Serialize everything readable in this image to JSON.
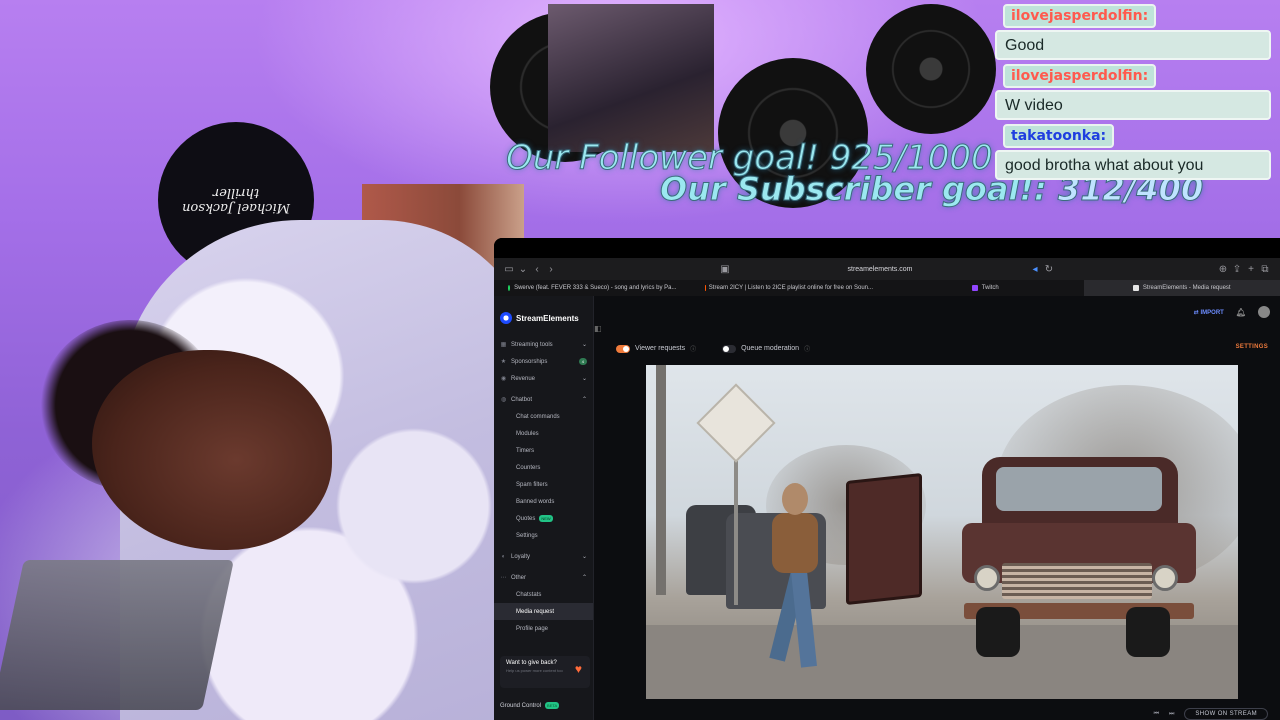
{
  "overlay": {
    "follower_goal": "Our Follower goal! 925/1000",
    "subscriber_goal_label": "Our Subscriber goal!:",
    "subscriber_goal_value": "312/400",
    "record_text": "Michael Jackson thriller"
  },
  "chat": [
    {
      "user": "ilovejasperdolfin:",
      "message": "Good",
      "user_color": "#ff5a4e"
    },
    {
      "user": "ilovejasperdolfin:",
      "message": "W video",
      "user_color": "#ff5a4e"
    },
    {
      "user": "takatoonka:",
      "message": "good brotha what about you",
      "user_color": "#1f3ee0"
    }
  ],
  "browser": {
    "url": "streamelements.com",
    "tabs": [
      {
        "label": "Swerve (feat. FEVER 333 & Sueco) - song and lyrics by Pa...",
        "color": "#1ed760"
      },
      {
        "label": "Stream 2ICY | Listen to 2ICE playlist online for free on Soun...",
        "color": "#ff5500"
      },
      {
        "label": "Twitch",
        "color": "#9146ff"
      },
      {
        "label": "StreamElements - Media request",
        "color": "#e6e6e6"
      }
    ]
  },
  "app": {
    "brand": "StreamElements",
    "import_label": "IMPORT",
    "settings_label": "SETTINGS",
    "viewer_requests_label": "Viewer requests",
    "queue_moderation_label": "Queue moderation",
    "show_on_stream_label": "SHOW ON STREAM",
    "sidebar": {
      "streaming_tools": "Streaming tools",
      "sponsorships": "Sponsorships",
      "sponsorships_count": "4",
      "revenue": "Revenue",
      "chatbot": "Chatbot",
      "chatbot_items": [
        "Chat commands",
        "Modules",
        "Timers",
        "Counters",
        "Spam filters",
        "Banned words",
        "Quotes",
        "Settings"
      ],
      "quotes_badge": "NEW",
      "loyalty": "Loyalty",
      "other": "Other",
      "other_items": [
        "Chatstats",
        "Media request",
        "Profile page"
      ],
      "give_back_title": "Want to give back?",
      "give_back_sub": "Help us power more content too",
      "ground_control": "Ground Control",
      "ground_control_badge": "BETA"
    }
  }
}
